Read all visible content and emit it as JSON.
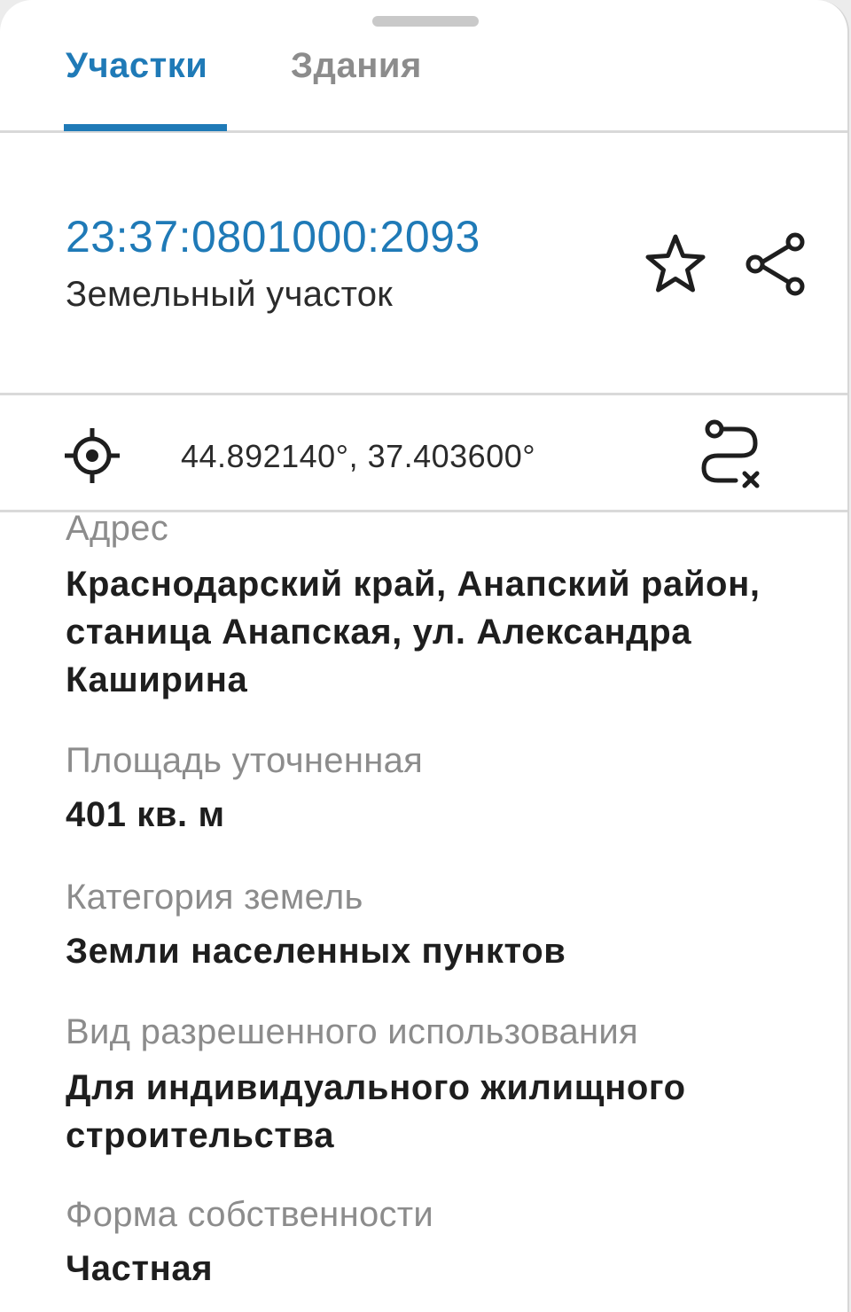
{
  "tabs": [
    {
      "label": "Участки",
      "active": true
    },
    {
      "label": "Здания",
      "active": false
    }
  ],
  "object": {
    "cadastral_number": "23:37:0801000:2093",
    "type": "Земельный участок"
  },
  "coordinates": {
    "text": "44.892140°, 37.403600°"
  },
  "fields": [
    {
      "label": "Адрес",
      "value": "Краснодарский край, Анапский район, станица Анапская, ул. Александра Каширина"
    },
    {
      "label": "Площадь уточненная",
      "value": "401 кв. м"
    },
    {
      "label": "Категория земель",
      "value": "Земли населенных пунктов"
    },
    {
      "label": "Вид разрешенного использования",
      "value": "Для индивидуального жилищного строительства"
    },
    {
      "label": "Форма собственности",
      "value": "Частная"
    }
  ],
  "icons": {
    "favorite": "star-icon",
    "share": "share-icon",
    "locate": "crosshair-icon",
    "route": "route-icon"
  },
  "colors": {
    "accent": "#1f7ab7",
    "label": "#8c8c8c",
    "text": "#1e1e1e"
  }
}
